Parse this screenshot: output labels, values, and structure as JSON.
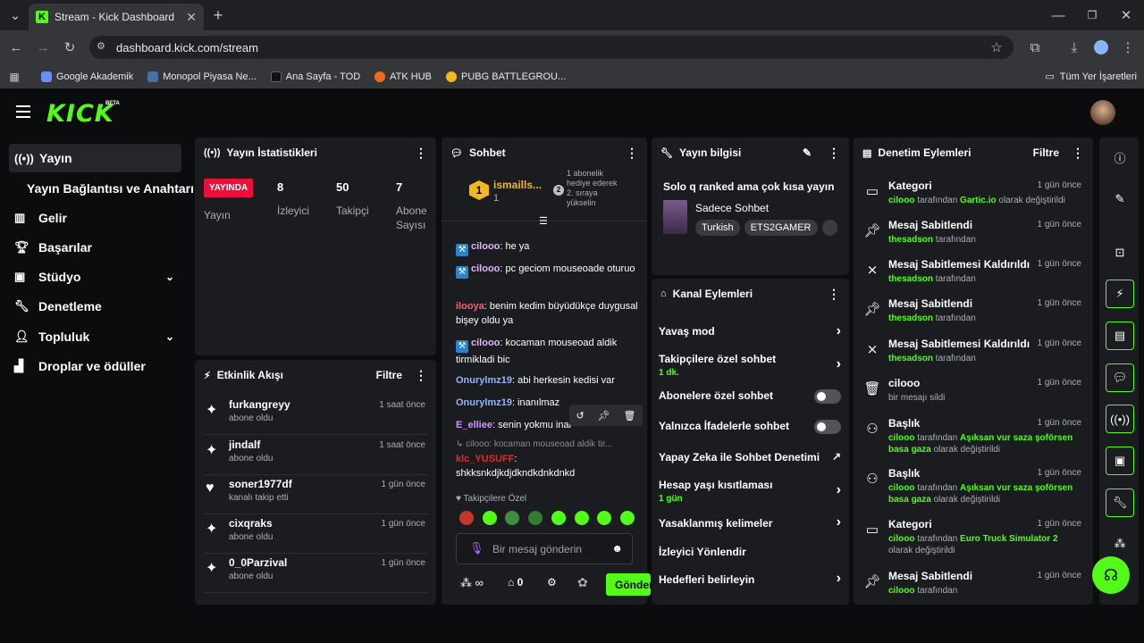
{
  "browser": {
    "tab_title": "Stream - Kick Dashboard",
    "url": "dashboard.kick.com/stream",
    "bookmarks": [
      "Google Akademik",
      "Monopol Piyasa Ne...",
      "Ana Sayfa - TOD",
      "ATK HUB",
      "PUBG BATTLEGROU..."
    ],
    "all_bookmarks": "Tüm Yer İşaretleri"
  },
  "app": {
    "logo": "KICK",
    "beta": "BETA"
  },
  "sidebar": {
    "items": [
      "Yayın",
      "Yayın Bağlantısı ve Anahtarı",
      "Gelir",
      "Başarılar",
      "Stüdyo",
      "Denetleme",
      "Topluluk",
      "Droplar ve ödüller"
    ]
  },
  "stats": {
    "title": "Yayın İstatistikleri",
    "live_badge": "YAYINDA",
    "stream_label": "Yayın",
    "viewers": {
      "value": "8",
      "label": "İzleyici"
    },
    "followers": {
      "value": "50",
      "label": "Takipçi"
    },
    "subs": {
      "value": "7",
      "label1": "Abone",
      "label2": "Sayısı"
    }
  },
  "activity": {
    "title": "Etkinlik Akışı",
    "filter": "Filtre",
    "rows": [
      {
        "name": "furkangreyy",
        "sub": "abone oldu",
        "time": "1 saat önce"
      },
      {
        "name": "jindalf",
        "sub": "abone oldu",
        "time": "1 saat önce"
      },
      {
        "name": "soner1977df",
        "sub": "kanalı takip etti",
        "time": "1 gün önce"
      },
      {
        "name": "cixqraks",
        "sub": "abone oldu",
        "time": "1 gün önce"
      },
      {
        "name": "0_0Parzival",
        "sub": "abone oldu",
        "time": "1 gün önce"
      }
    ]
  },
  "chat": {
    "title": "Sohbet",
    "top_gifter": "ismaills...",
    "top_count": "1",
    "gift_rank": "2",
    "gift_text": "1 abonelik hediye ederek 2. sıraya yükselin",
    "messages": [
      {
        "user": "cilooo",
        "text": "he ya"
      },
      {
        "user": "cilooo",
        "text": "pc geciom mouseoade oturuo"
      },
      {
        "user": "ilooya",
        "text": "benim kedim büyüdükçe duygusal bişey oldu ya"
      },
      {
        "user": "cilooo",
        "text": "kocaman mouseoad aldik tirmikladi bic"
      },
      {
        "user": "Onurylmz19",
        "text": "abi herkesin kedisi var"
      },
      {
        "user": "Onurylmz19",
        "text": "inanılmaz"
      },
      {
        "user": "E_elliee",
        "text": "senin yokmu inan"
      },
      {
        "reply": "cilooo: kocaman mouseoad aldik tir...",
        "user": "klc_YUSUFF",
        "text": "shkksnkdjkdjdkndkdnkdnkd"
      }
    ],
    "followers_only": "Takipçilere Özel",
    "placeholder": "Bir mesaj gönderin",
    "store_count": "0",
    "send": "Gönder"
  },
  "stream_info": {
    "title": "Yayın bilgisi",
    "stream_title": "Solo q ranked ama çok kısa yayın",
    "category": "Sadece Sohbet",
    "tags": [
      "Turkish",
      "ETS2GAMER"
    ]
  },
  "channel_actions": {
    "title": "Kanal Eylemleri",
    "items": [
      {
        "label": "Yavaş mod"
      },
      {
        "label": "Takipçilere özel sohbet",
        "sub": "1 dk."
      },
      {
        "label": "Abonelere özel sohbet"
      },
      {
        "label": "Yalnızca İfadelerle sohbet"
      },
      {
        "label": "Yapay Zeka ile Sohbet Denetimi"
      },
      {
        "label": "Hesap yaşı kısıtlaması",
        "sub": "1 gün"
      },
      {
        "label": "Yasaklanmış kelimeler"
      },
      {
        "label": "İzleyici Yönlendir"
      },
      {
        "label": "Hedefleri belirleyin"
      }
    ]
  },
  "moderation": {
    "title": "Denetim Eylemleri",
    "filter": "Filtre",
    "rows": [
      {
        "title": "Kategori",
        "u": "cilooo",
        "mid": " tarafından ",
        "v": "Gartic.io",
        "end": " olarak değiştirildi",
        "time": "1 gün önce"
      },
      {
        "title": "Mesaj Sabitlendi",
        "u": "thesadson",
        "mid": " tarafından",
        "v": "",
        "end": "",
        "time": "1 gün önce"
      },
      {
        "title": "Mesaj Sabitlemesi Kaldırıldı",
        "u": "thesadson",
        "mid": " tarafından",
        "v": "",
        "end": "",
        "time": "1 gün önce"
      },
      {
        "title": "Mesaj Sabitlendi",
        "u": "thesadson",
        "mid": " tarafından",
        "v": "",
        "end": "",
        "time": "1 gün önce"
      },
      {
        "title": "Mesaj Sabitlemesi Kaldırıldı",
        "u": "thesadson",
        "mid": " tarafından",
        "v": "",
        "end": "",
        "time": "1 gün önce"
      },
      {
        "title": "cilooo",
        "u": "",
        "mid": "bir mesajı sildi",
        "v": "",
        "end": "",
        "time": "1 gün önce"
      },
      {
        "title": "Başlık",
        "u": "cilooo",
        "mid": " tarafından ",
        "v": "Aşıksan vur saza şoförsen basa gaza",
        "end": " olarak değiştirildi",
        "time": "1 gün önce"
      },
      {
        "title": "Başlık",
        "u": "cilooo",
        "mid": " tarafından ",
        "v": "Aşıksan vur saza şoförsen basa gaza",
        "end": " olarak değiştirildi",
        "time": "1 gün önce"
      },
      {
        "title": "Kategori",
        "u": "cilooo",
        "mid": " tarafından ",
        "v": "Euro Truck Simulator 2",
        "end": " olarak değiştirildi",
        "time": "1 gün önce"
      },
      {
        "title": "Mesaj Sabitlendi",
        "u": "cilooo",
        "mid": " tarafından",
        "v": "",
        "end": "",
        "time": "1 gün önce"
      }
    ]
  },
  "colors": {
    "accent": "#53fc18",
    "live": "#e9113c",
    "panel": "#1b1c1f"
  }
}
